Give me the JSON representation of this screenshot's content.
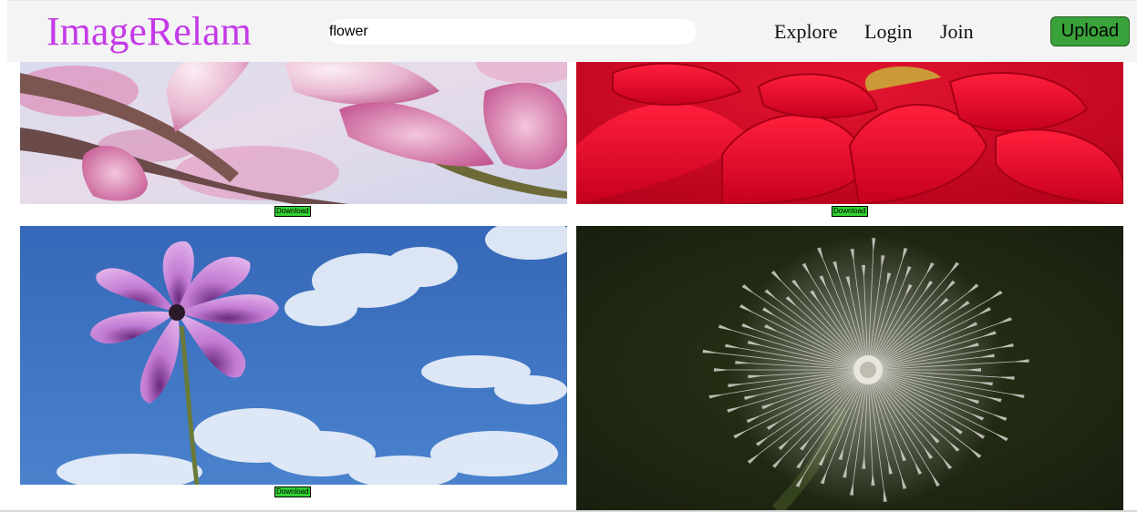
{
  "header": {
    "logo": "ImageRelam",
    "search_value": "flower",
    "nav": [
      "Explore",
      "Login",
      "Join"
    ],
    "upload_label": "Upload"
  },
  "gallery": {
    "download_label": "Download",
    "items": [
      {
        "subject": "pink magnolia blossoms"
      },
      {
        "subject": "red dahlia petals"
      },
      {
        "subject": "pink cosmos flower against blue sky"
      },
      {
        "subject": "dandelion seed head on dark background"
      }
    ]
  },
  "colors": {
    "logo": "#c43be6",
    "upload_button": "#3aa23a",
    "download_button": "#33d133",
    "navbar_bg": "#f4f4f4"
  }
}
